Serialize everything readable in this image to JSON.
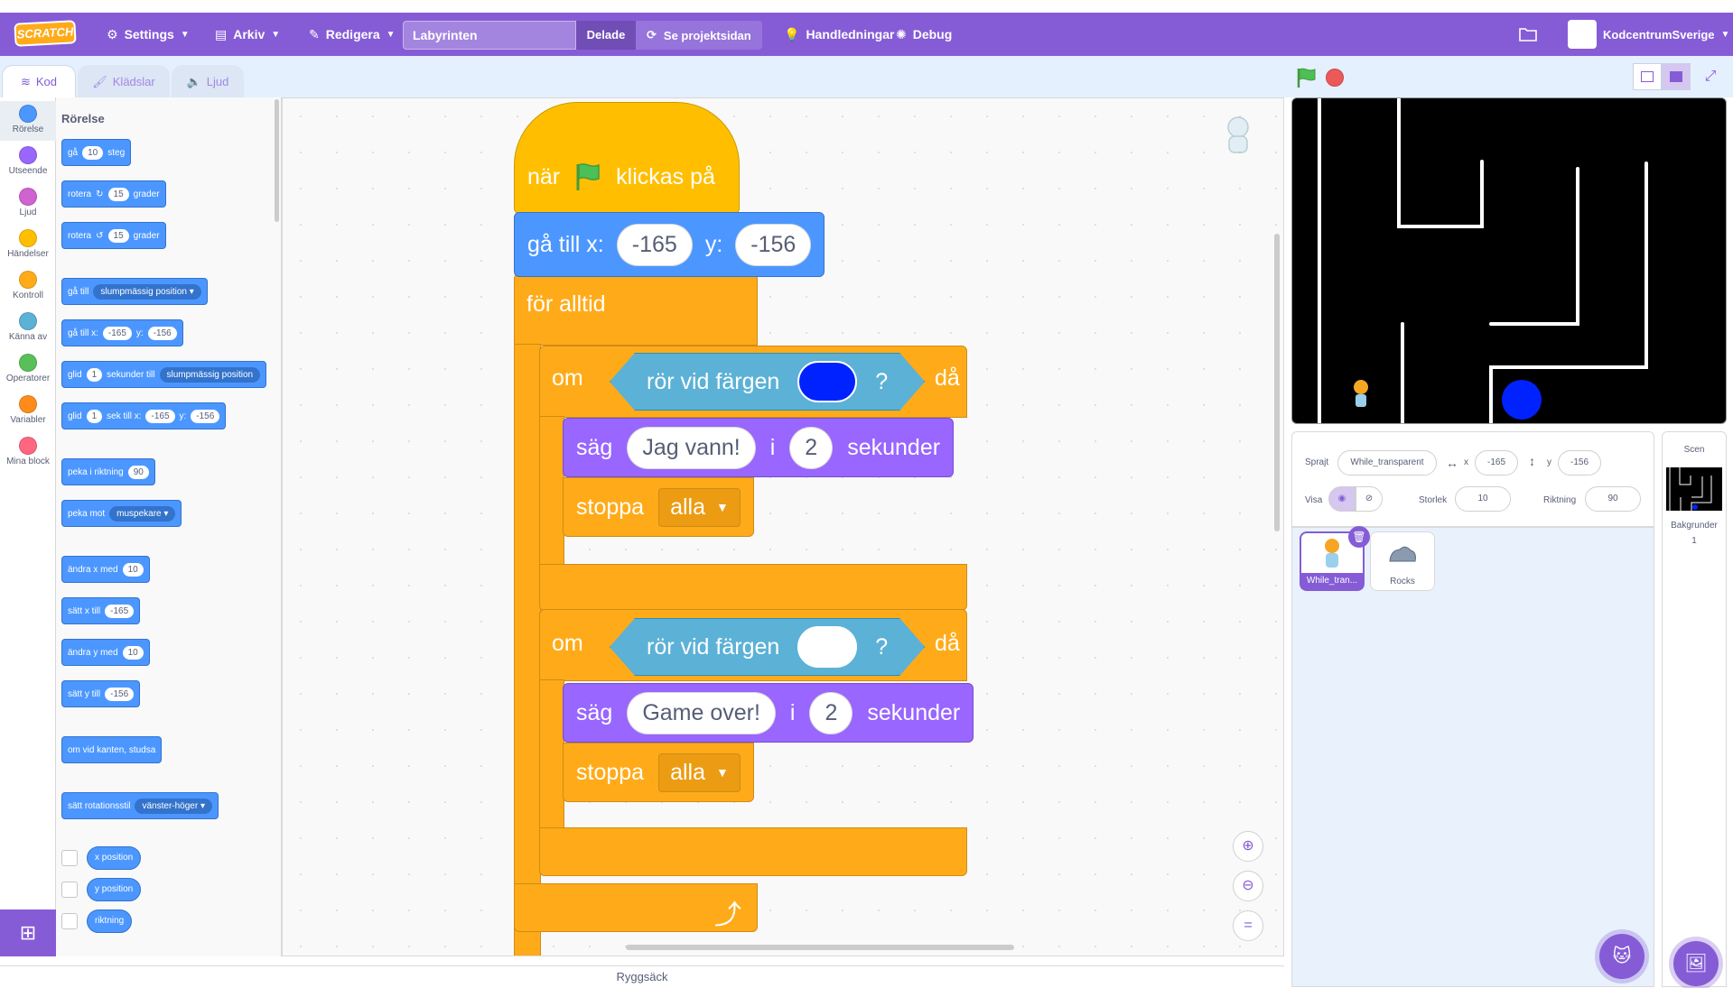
{
  "menubar": {
    "logo": "SCRATCH",
    "settings": "Settings",
    "file": "Arkiv",
    "edit": "Redigera",
    "project_title": "Labyrinten",
    "shared": "Delade",
    "see_project": "Se projektsidan",
    "tutorials": "Handledningar",
    "debug": "Debug",
    "user": "KodcentrumSverige"
  },
  "tabs": {
    "code": "Kod",
    "costumes": "Klädslar",
    "sounds": "Ljud"
  },
  "categories": [
    {
      "label": "Rörelse",
      "color": "#4c97ff"
    },
    {
      "label": "Utseende",
      "color": "#9966ff"
    },
    {
      "label": "Ljud",
      "color": "#cf63cf"
    },
    {
      "label": "Händelser",
      "color": "#ffbf00"
    },
    {
      "label": "Kontroll",
      "color": "#ffab19"
    },
    {
      "label": "Känna av",
      "color": "#5cb1d6"
    },
    {
      "label": "Operatorer",
      "color": "#59c059"
    },
    {
      "label": "Variabler",
      "color": "#ff8c1a"
    },
    {
      "label": "Mina block",
      "color": "#ff6680"
    }
  ],
  "palette": {
    "title": "Rörelse",
    "move": {
      "a": "gå",
      "v": "10",
      "b": "steg"
    },
    "turn_right": {
      "a": "rotera",
      "v": "15",
      "b": "grader"
    },
    "turn_left": {
      "a": "rotera",
      "v": "15",
      "b": "grader"
    },
    "goto": {
      "a": "gå till",
      "dd": "slumpmässig position"
    },
    "goto_xy": {
      "a": "gå till x:",
      "x": "-165",
      "b": "y:",
      "y": "-156"
    },
    "glide_to": {
      "a": "glid",
      "v": "1",
      "b": "sekunder till",
      "dd": "slumpmässig position"
    },
    "glide_xy": {
      "a": "glid",
      "v": "1",
      "b": "sek till x:",
      "x": "-165",
      "c": "y:",
      "y": "-156"
    },
    "point_dir": {
      "a": "peka i riktning",
      "v": "90"
    },
    "point_to": {
      "a": "peka mot",
      "dd": "muspekare"
    },
    "change_x": {
      "a": "ändra x med",
      "v": "10"
    },
    "set_x": {
      "a": "sätt x till",
      "v": "-165"
    },
    "change_y": {
      "a": "ändra y med",
      "v": "10"
    },
    "set_y": {
      "a": "sätt y till",
      "v": "-156"
    },
    "bounce": "om vid kanten, studsa",
    "rotation_style": {
      "a": "sätt rotationsstil",
      "dd": "vänster-höger"
    },
    "reporters": [
      "x position",
      "y position",
      "riktning"
    ]
  },
  "script": {
    "hat": {
      "a": "när",
      "b": "klickas på"
    },
    "goto": {
      "a": "gå till x:",
      "x": "-165",
      "b": "y:",
      "y": "-156"
    },
    "forever": "för alltid",
    "if1": {
      "a": "om",
      "sensing": "rör vid färgen",
      "q": "?",
      "b": "då",
      "color": "#0022ff"
    },
    "say1": {
      "a": "säg",
      "msg": "Jag vann!",
      "i": "i",
      "secs": "2",
      "b": "sekunder"
    },
    "stop1": {
      "a": "stoppa",
      "dd": "alla"
    },
    "if2": {
      "a": "om",
      "sensing": "rör vid färgen",
      "q": "?",
      "b": "då",
      "color": "#ffffff"
    },
    "say2": {
      "a": "säg",
      "msg": "Game over!",
      "i": "i",
      "secs": "2",
      "b": "sekunder"
    },
    "stop2": {
      "a": "stoppa",
      "dd": "alla"
    }
  },
  "sprite_info": {
    "sprite_label": "Sprajt",
    "sprite_name": "While_transparent",
    "x_label": "x",
    "x": "-165",
    "y_label": "y",
    "y": "-156",
    "show_label": "Visa",
    "size_label": "Storlek",
    "size": "10",
    "direction_label": "Riktning",
    "direction": "90"
  },
  "sprites": [
    {
      "name": "While_tran...",
      "selected": true
    },
    {
      "name": "Rocks",
      "selected": false
    }
  ],
  "stage_pane": {
    "title": "Scen",
    "backdrops_label": "Bakgrunder",
    "backdrops_count": "1"
  },
  "backpack": "Ryggsäck"
}
